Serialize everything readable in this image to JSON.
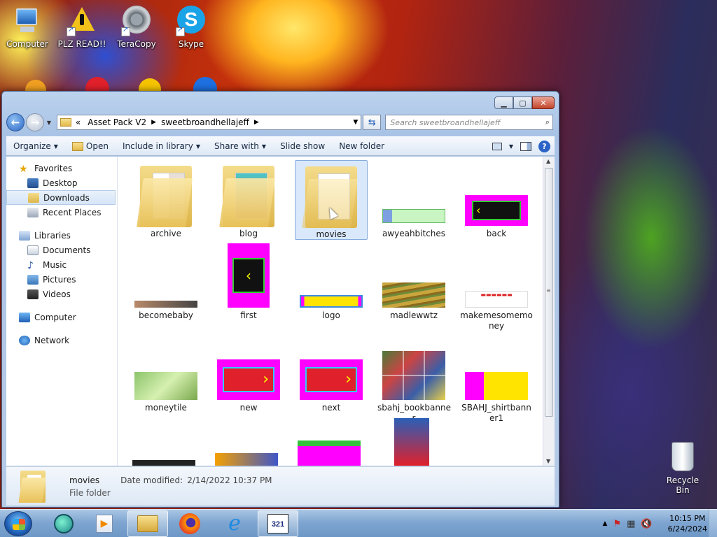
{
  "desktop": {
    "icons": [
      {
        "label": "Computer",
        "icon": "computer-icon"
      },
      {
        "label": "PLZ READ!!",
        "icon": "warning-icon"
      },
      {
        "label": "TeraCopy",
        "icon": "teracopy-icon"
      },
      {
        "label": "Skype",
        "icon": "skype-icon"
      }
    ],
    "recycle_bin": "Recycle Bin"
  },
  "window": {
    "address": {
      "overflow": "«",
      "path": [
        "Asset Pack V2",
        "sweetbroandhellajeff"
      ]
    },
    "search_placeholder": "Search sweetbroandhellajeff",
    "toolbar": {
      "organize": "Organize",
      "open": "Open",
      "include_in_library": "Include in library",
      "share_with": "Share with",
      "slide_show": "Slide show",
      "new_folder": "New folder"
    },
    "nav": {
      "favorites": "Favorites",
      "desktop": "Desktop",
      "downloads": "Downloads",
      "recent_places": "Recent Places",
      "libraries": "Libraries",
      "documents": "Documents",
      "music": "Music",
      "pictures": "Pictures",
      "videos": "Videos",
      "computer": "Computer",
      "network": "Network"
    },
    "files": [
      {
        "name": "archive",
        "kind": "folder"
      },
      {
        "name": "blog",
        "kind": "folder"
      },
      {
        "name": "movies",
        "kind": "folder",
        "selected": true
      },
      {
        "name": "awyeahbitches",
        "kind": "image"
      },
      {
        "name": "back",
        "kind": "image"
      },
      {
        "name": "becomebaby",
        "kind": "image"
      },
      {
        "name": "first",
        "kind": "image"
      },
      {
        "name": "logo",
        "kind": "image"
      },
      {
        "name": "madlewwtz",
        "kind": "image"
      },
      {
        "name": "makemesomemo ney",
        "kind": "image"
      },
      {
        "name": "moneytile",
        "kind": "image"
      },
      {
        "name": "new",
        "kind": "image"
      },
      {
        "name": "next",
        "kind": "image"
      },
      {
        "name": "sbahj_bookbanne r",
        "kind": "image"
      },
      {
        "name": "SBAHJ_shirtbann er1",
        "kind": "image"
      }
    ],
    "details": {
      "name": "movies",
      "date_label": "Date modified:",
      "date_value": "2/14/2022 10:37 PM",
      "type": "File folder"
    }
  },
  "taskbar": {
    "apps": [
      "media-player-icon",
      "media-center-icon",
      "explorer-icon",
      "firefox-icon",
      "ie-icon",
      "video-editor-icon"
    ],
    "time": "10:15 PM",
    "date": "6/24/2024"
  },
  "colors": {
    "selection": "#d9e8fb",
    "magenta_thumb": "#ff00ff",
    "link_blue": "#1b5fc4"
  }
}
